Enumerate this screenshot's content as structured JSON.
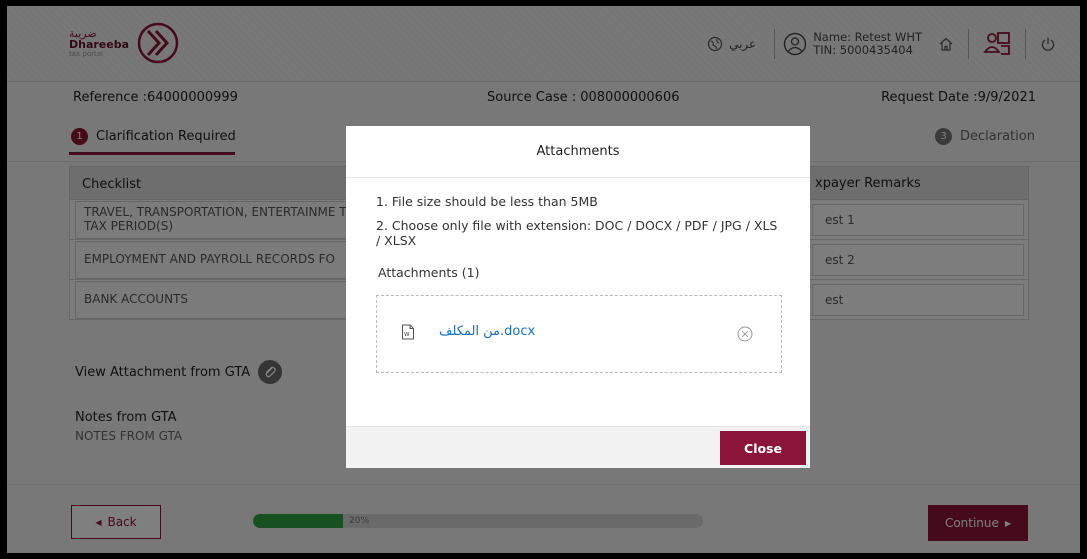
{
  "brand": {
    "arabic": "ضريبة",
    "name": "Dhareeba",
    "subtitle": "tax portal",
    "color": "#8a1538"
  },
  "header": {
    "language_label": "عربي",
    "user_name": "Name: Retest WHT",
    "user_tin": "TIN: 5000435404",
    "icons": [
      "globe-icon",
      "user-icon",
      "home-icon",
      "user-switch-icon",
      "power-icon"
    ]
  },
  "info": {
    "reference": "Reference :64000000999",
    "source_case": "Source Case : 008000000606",
    "request_date": "Request Date :9/9/2021"
  },
  "steps": [
    {
      "number": "1",
      "label": "Clarification Required"
    },
    {
      "number": "3",
      "label": "Declaration"
    }
  ],
  "checklist": {
    "header_left": "Checklist",
    "header_right": "xpayer Remarks",
    "rows": [
      {
        "item": "TRAVEL, TRANSPORTATION, ENTERTAINME THE TAX PERIOD(S)",
        "remark": "est 1"
      },
      {
        "item": "EMPLOYMENT AND PAYROLL RECORDS FO",
        "remark": "est 2"
      },
      {
        "item": "BANK ACCOUNTS",
        "remark": "est"
      }
    ]
  },
  "view_attachment": "View Attachment from GTA",
  "notes": {
    "label": "Notes from GTA",
    "value": "NOTES FROM GTA"
  },
  "footer": {
    "back": "Back",
    "continue": "Continue",
    "progress_text": "20%",
    "progress_value": 20
  },
  "modal": {
    "title": "Attachments",
    "rule1": "1. File size should be less than 5MB",
    "rule2": "2. Choose only file with extension: DOC / DOCX / PDF / JPG / XLS / XLSX",
    "attachments_label": "Attachments (1)",
    "file_name": "من المكلف.docx",
    "close": "Close"
  }
}
